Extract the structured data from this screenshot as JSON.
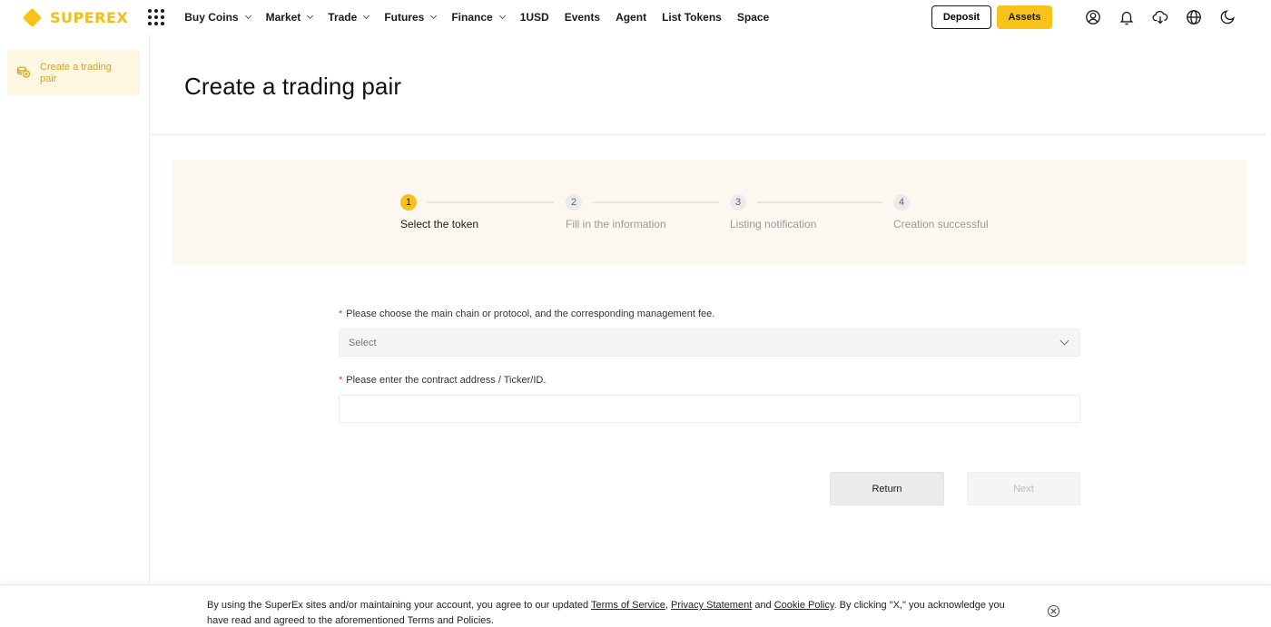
{
  "brand": {
    "name": "SUPEREX",
    "color": "#f7c21a"
  },
  "nav": {
    "items": [
      {
        "label": "Buy Coins",
        "dropdown": true
      },
      {
        "label": "Market",
        "dropdown": true
      },
      {
        "label": "Trade",
        "dropdown": true
      },
      {
        "label": "Futures",
        "dropdown": true
      },
      {
        "label": "Finance",
        "dropdown": true
      },
      {
        "label": "1USD",
        "dropdown": false
      },
      {
        "label": "Events",
        "dropdown": false
      },
      {
        "label": "Agent",
        "dropdown": false
      },
      {
        "label": "List Tokens",
        "dropdown": false
      },
      {
        "label": "Space",
        "dropdown": false
      }
    ],
    "deposit_label": "Deposit",
    "assets_label": "Assets",
    "icons": [
      "user-icon",
      "bell-icon",
      "download-icon",
      "globe-icon",
      "moon-icon"
    ]
  },
  "sidebar": {
    "items": [
      {
        "label": "Create a trading pair",
        "icon": "coins-icon",
        "active": true
      }
    ]
  },
  "main": {
    "title": "Create a trading pair",
    "steps": [
      {
        "number": "1",
        "label": "Select the token",
        "active": true
      },
      {
        "number": "2",
        "label": "Fill in the information",
        "active": false
      },
      {
        "number": "3",
        "label": "Listing notification",
        "active": false
      },
      {
        "number": "4",
        "label": "Creation successful",
        "active": false
      }
    ],
    "form": {
      "chain": {
        "required_mark": "*",
        "label": "Please choose the main chain or protocol, and the corresponding management fee.",
        "placeholder": "Select"
      },
      "contract": {
        "required_mark": "*",
        "label": "Please enter the contract address / Ticker/ID.",
        "value": ""
      }
    },
    "return_label": "Return",
    "next_label": "Next"
  },
  "cookie": {
    "text_before": "By using the SuperEx sites and/or maintaining your account, you agree to our updated ",
    "terms_link": "Terms of Service",
    "sep1": ", ",
    "privacy_link": "Privacy Statement",
    "sep2": " and ",
    "cookie_link": "Cookie Policy",
    "text_after": ". By clicking \"X,\" you acknowledge you have read and agreed to the aforementioned Terms and Policies."
  }
}
